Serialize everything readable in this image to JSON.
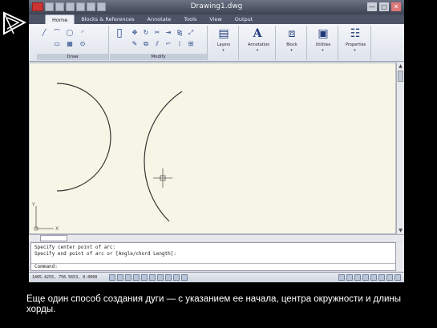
{
  "window": {
    "title": "Drawing1.dwg",
    "minimize": "—",
    "maximize": "□",
    "close": "✕"
  },
  "tabs": [
    {
      "label": "Home",
      "active": true
    },
    {
      "label": "Blocks & References",
      "active": false
    },
    {
      "label": "Annotate",
      "active": false
    },
    {
      "label": "Tools",
      "active": false
    },
    {
      "label": "View",
      "active": false
    },
    {
      "label": "Output",
      "active": false
    }
  ],
  "ribbon": {
    "draw_label": "Draw",
    "modify_label": "Modify",
    "layers_label": "Layers",
    "annotation_label": "Annotation",
    "block_label": "Block",
    "utilities_label": "Utilities",
    "properties_label": "Properties"
  },
  "scroll": {
    "up": "▲",
    "down": "▼"
  },
  "ucs": {
    "y_label": "Y",
    "x_label": "X"
  },
  "command": {
    "history": [
      "Specify center point of arc:",
      "Specify end point of arc or [Angle/chord Length]:"
    ],
    "prompt": "Command:"
  },
  "status": {
    "coordinates": "1405.4255, 756.5653, 0.0000"
  },
  "caption": "Еще один способ создания дуги — с указанием ее начала, центра окружности и длины хорды.",
  "colors": {
    "drawing_bg": "#f7f6e6",
    "title_bg": "#3d4352",
    "caption_text": "#ffffff"
  }
}
